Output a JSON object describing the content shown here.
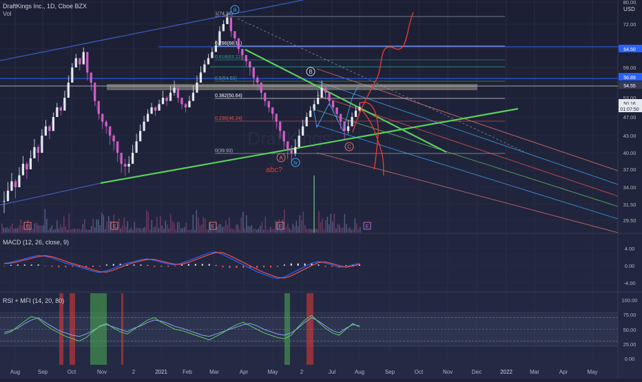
{
  "header": {
    "symbol_line": "DraftKings Inc., 1D, Cboe BZX",
    "volume_label": "Vol",
    "currency": "USD"
  },
  "panes": {
    "macd_title": "MACD (12, 26, close, 9)",
    "rsi_title": "RSI + MFI (14, 20, 80)"
  },
  "chart_data": [
    {
      "type": "line",
      "pane": "price",
      "x_tick_labels": [
        "Aug",
        "Sep",
        "Oct",
        "Nov",
        "2",
        "2021",
        "Feb",
        "Mar",
        "Apr",
        "May",
        "2",
        "Jul",
        "Aug",
        "Sep",
        "Oct",
        "Nov",
        "Dec",
        "2022",
        "Mar",
        "Apr",
        "May"
      ],
      "y_tick_labels": [
        "80.00",
        "72.00",
        "65.00",
        "59.00",
        "53.00",
        "47.00",
        "43.00",
        "40.00",
        "37.00",
        "34.00",
        "31.50",
        "29.50"
      ],
      "price_labels": [
        {
          "text": "64.50",
          "color": "#2962ff"
        },
        {
          "text": "56.89",
          "color": "#2962ff"
        },
        {
          "text": "54.55",
          "color": "#b2b5be"
        },
        {
          "text": "50.16",
          "color": "#2a2e39"
        },
        {
          "text": "01:07:50",
          "color": "#2a2e39"
        }
      ],
      "fib_levels": [
        {
          "ratio": "1",
          "price": "74.38"
        },
        {
          "ratio": "0.786",
          "price": "68.11"
        },
        {
          "ratio": "0.618",
          "price": "63.22"
        },
        {
          "ratio": "0.5",
          "price": "54.50"
        },
        {
          "ratio": "0.382",
          "price": "50.64"
        },
        {
          "ratio": "0.236",
          "price": "46.24"
        },
        {
          "ratio": "0",
          "price": "39.93"
        }
      ],
      "wave_labels": [
        "B",
        "A",
        "C",
        "iv",
        "iii"
      ],
      "annotation": "abc?",
      "earnings_marker": "E",
      "watermark": "DraftKings",
      "close_price": 50.16,
      "series": [
        {
          "values": [
            32,
            33.5,
            35,
            34,
            36,
            38,
            37,
            39,
            41,
            40,
            43,
            45,
            44,
            47,
            50,
            49,
            53,
            56,
            59,
            62,
            60,
            64,
            58,
            56,
            52,
            48,
            46,
            45,
            43,
            42,
            40,
            38,
            37.5,
            38,
            40,
            42,
            44,
            46,
            48,
            50,
            49,
            51,
            53,
            52,
            54,
            55,
            53,
            51,
            50,
            52,
            54,
            56,
            58,
            60,
            62,
            64,
            66,
            70,
            72,
            74.38,
            70,
            68,
            65,
            63,
            61,
            59,
            57,
            56,
            54,
            52,
            50,
            48,
            46,
            44,
            42,
            40.5,
            39.93,
            41,
            43,
            45,
            47,
            49,
            51,
            53,
            55,
            54,
            52,
            50,
            48,
            46,
            44,
            45,
            47,
            49,
            50.16
          ]
        }
      ]
    },
    {
      "type": "bar",
      "pane": "macd",
      "y_tick_labels": [
        "4.00",
        "0.00",
        "-4.00"
      ],
      "series": [
        {
          "values": [
            0.5,
            0.8,
            1.2,
            1.6,
            2.0,
            2.4,
            2.2,
            1.8,
            1.2,
            0.6,
            0.2,
            -0.3,
            -0.8,
            -1.3,
            -1.6,
            -1.2,
            -0.6,
            0.1,
            0.6,
            1.0,
            1.4,
            1.6,
            1.2,
            0.8,
            0.4,
            0.2,
            0.6,
            1.2,
            1.8,
            2.4,
            3.0,
            3.2,
            2.6,
            1.8,
            1.0,
            0.2,
            -0.6,
            -1.4,
            -2.0,
            -2.6,
            -3.0,
            -2.6,
            -1.8,
            -1.0,
            -0.2,
            0.6,
            1.0,
            0.6,
            0.2,
            -0.4,
            -0.2,
            0.2,
            0.6
          ]
        }
      ]
    },
    {
      "type": "line",
      "pane": "rsi",
      "y_tick_labels": [
        "100.00",
        "75.00",
        "50.00",
        "25.00",
        "0.00"
      ],
      "series": [
        {
          "values": [
            45,
            48,
            52,
            60,
            66,
            70,
            62,
            55,
            48,
            44,
            40,
            38,
            42,
            48,
            55,
            58,
            54,
            50,
            46,
            52,
            56,
            62,
            66,
            64,
            60,
            55,
            52,
            48,
            44,
            40,
            38,
            42,
            46,
            50,
            54,
            58,
            60,
            56,
            50,
            46,
            42,
            40,
            44,
            52,
            62,
            70,
            64,
            56,
            48,
            44,
            52,
            58,
            56
          ]
        },
        {
          "values": [
            42,
            46,
            55,
            64,
            72,
            68,
            58,
            50,
            44,
            38,
            34,
            30,
            36,
            46,
            56,
            60,
            52,
            46,
            42,
            50,
            58,
            66,
            70,
            62,
            56,
            50,
            48,
            44,
            40,
            36,
            32,
            38,
            44,
            52,
            58,
            62,
            56,
            50,
            44,
            40,
            36,
            34,
            40,
            54,
            66,
            74,
            62,
            52,
            44,
            40,
            50,
            60,
            54
          ]
        }
      ]
    }
  ]
}
